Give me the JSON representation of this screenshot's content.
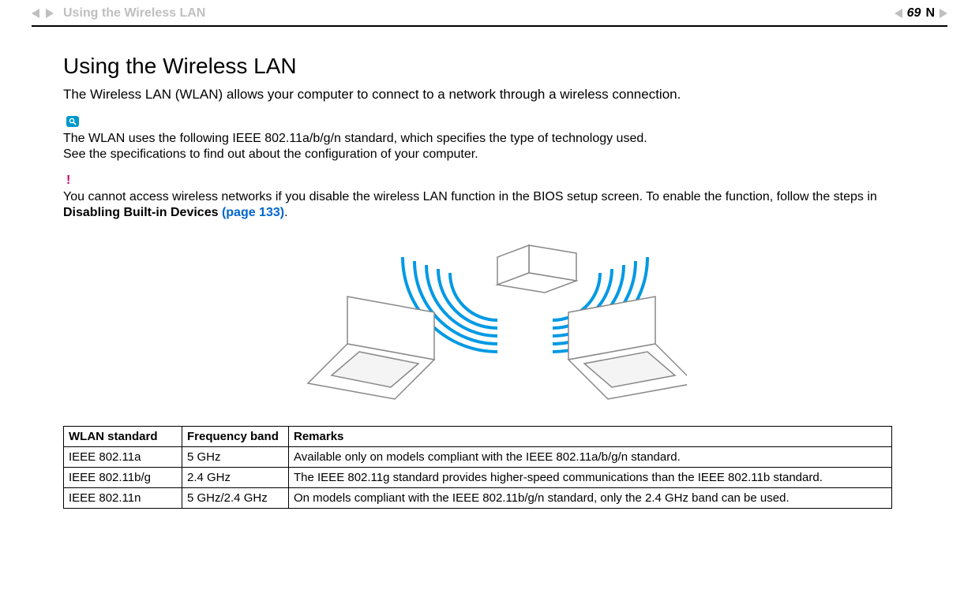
{
  "header": {
    "running_title": "Using the Wireless LAN",
    "page_number": "69",
    "right_letter": "N"
  },
  "section": {
    "title": "Using the Wireless LAN",
    "intro": "The Wireless LAN (WLAN) allows your computer to connect to a network through a wireless connection."
  },
  "note": {
    "line1": "The WLAN uses the following IEEE 802.11a/b/g/n standard, which specifies the type of technology used.",
    "line2": "See the specifications to find out about the configuration of your computer."
  },
  "warning": {
    "prefix": "You cannot access wireless networks if you disable the wireless LAN function in the BIOS setup screen. To enable the function, follow the steps in ",
    "bold_text": "Disabling Built-in Devices ",
    "page_link": "(page 133)",
    "suffix": "."
  },
  "table": {
    "headers": [
      "WLAN standard",
      "Frequency band",
      "Remarks"
    ],
    "rows": [
      {
        "standard": "IEEE 802.11a",
        "band": "5 GHz",
        "remark": "Available only on models compliant with the IEEE 802.11a/b/g/n standard."
      },
      {
        "standard": "IEEE 802.11b/g",
        "band": "2.4 GHz",
        "remark": "The IEEE 802.11g standard provides higher-speed communications than the IEEE 802.11b standard."
      },
      {
        "standard": "IEEE 802.11n",
        "band": "5 GHz/2.4 GHz",
        "remark": "On models compliant with the IEEE 802.11b/g/n standard, only the 2.4 GHz band can be used."
      }
    ]
  }
}
